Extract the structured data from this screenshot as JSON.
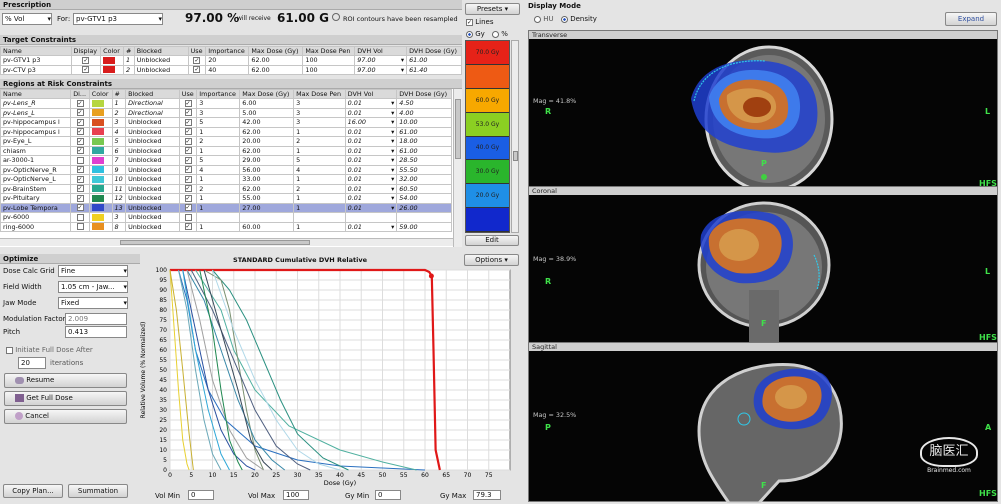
{
  "prescription": {
    "title": "Prescription",
    "type": "% Vol",
    "for_label": "For:",
    "target": "pv-GTV1 p3",
    "percent": "97.00 %",
    "receive_label": "will receive",
    "dose": "61.00 G",
    "msg": "ROI contours have been resampled"
  },
  "presets": {
    "label": "Presets",
    "lines_label": "Lines",
    "gy_label": "Gy",
    "pct_label": "%",
    "edit_label": "Edit",
    "bands": [
      {
        "color": "#e62218",
        "label": "70.0 Gy"
      },
      {
        "color": "#ee5a14",
        "label": ""
      },
      {
        "color": "#f7a800",
        "label": "60.0 Gy"
      },
      {
        "color": "#8bcf22",
        "label": "53.0 Gy"
      },
      {
        "color": "#1a5ee4",
        "label": "40.0 Gy"
      },
      {
        "color": "#2ab52c",
        "label": "30.0 Gy"
      },
      {
        "color": "#1f8fe6",
        "label": "20.0 Gy"
      },
      {
        "color": "#1128cc",
        "label": ""
      }
    ]
  },
  "target_constraints": {
    "title": "Target Constraints",
    "headers": [
      "Name",
      "Display",
      "Color",
      "#",
      "Blocked",
      "Use",
      "Importance",
      "Max Dose (Gy)",
      "Max Dose Pen",
      "DVH Vol",
      "DVH Dose (Gy)"
    ],
    "rows": [
      {
        "name": "pv-GTV1 p3",
        "display": "✓",
        "color": "#d81c1c",
        "num": "1",
        "blocked": "Unblocked",
        "use": "✓",
        "imp": "20",
        "maxd": "62.00",
        "pen": "100",
        "vol": "97.00",
        "dvhd": "61.00"
      },
      {
        "name": "pv-CTV p3",
        "display": "✓",
        "color": "#d81c1c",
        "num": "2",
        "blocked": "Unblocked",
        "use": "✓",
        "imp": "40",
        "maxd": "62.00",
        "pen": "100",
        "vol": "97.00",
        "dvhd": "61.40"
      }
    ]
  },
  "oar_constraints": {
    "title": "Regions at Risk Constraints",
    "headers": [
      "Name",
      "Di...",
      "Color",
      "#",
      "Blocked",
      "Use",
      "Importance",
      "Max Dose (Gy)",
      "Max Dose Pen",
      "DVH Vol",
      "DVH Dose (Gy)"
    ],
    "rows": [
      {
        "name": "pv-Lens_R",
        "display": "✓",
        "color": "#b6d640",
        "num": "1",
        "blocked": "Directional",
        "use": "✓",
        "imp": "3",
        "maxd": "6.00",
        "pen": "3",
        "vol": "0.01",
        "dvhd": "4.50",
        "sel": false
      },
      {
        "name": "pv-Lens_L",
        "display": "✓",
        "color": "#e8a020",
        "num": "2",
        "blocked": "Directional",
        "use": "✓",
        "imp": "3",
        "maxd": "5.00",
        "pen": "3",
        "vol": "0.01",
        "dvhd": "4.00",
        "sel": false
      },
      {
        "name": "pv-hippocampus l",
        "display": "✓",
        "color": "#d85020",
        "num": "3",
        "blocked": "Unblocked",
        "use": "✓",
        "imp": "5",
        "maxd": "42.00",
        "pen": "3",
        "vol": "16.00",
        "dvhd": "10.00",
        "sel": false
      },
      {
        "name": "pv-hippocampus l",
        "display": "✓",
        "color": "#e84050",
        "num": "4",
        "blocked": "Unblocked",
        "use": "✓",
        "imp": "1",
        "maxd": "62.00",
        "pen": "1",
        "vol": "0.01",
        "dvhd": "61.00",
        "sel": false
      },
      {
        "name": "pv-Eye_L",
        "display": "✓",
        "color": "#78c850",
        "num": "5",
        "blocked": "Unblocked",
        "use": "✓",
        "imp": "2",
        "maxd": "20.00",
        "pen": "2",
        "vol": "0.01",
        "dvhd": "18.00",
        "sel": false
      },
      {
        "name": "chiasm",
        "display": "✓",
        "color": "#30a8a0",
        "num": "6",
        "blocked": "Unblocked",
        "use": "✓",
        "imp": "1",
        "maxd": "62.00",
        "pen": "1",
        "vol": "0.01",
        "dvhd": "61.00",
        "sel": false
      },
      {
        "name": "ar-3000-1",
        "display": "",
        "color": "#e040d0",
        "num": "7",
        "blocked": "Unblocked",
        "use": "✓",
        "imp": "5",
        "maxd": "29.00",
        "pen": "5",
        "vol": "0.01",
        "dvhd": "28.50",
        "sel": false
      },
      {
        "name": "pv-OpticNerve_R",
        "display": "✓",
        "color": "#30c0e0",
        "num": "9",
        "blocked": "Unblocked",
        "use": "✓",
        "imp": "4",
        "maxd": "56.00",
        "pen": "4",
        "vol": "0.01",
        "dvhd": "55.50",
        "sel": false
      },
      {
        "name": "pv-OpticNerve_L",
        "display": "✓",
        "color": "#40c8d8",
        "num": "10",
        "blocked": "Unblocked",
        "use": "✓",
        "imp": "1",
        "maxd": "33.00",
        "pen": "1",
        "vol": "0.01",
        "dvhd": "32.00",
        "sel": false
      },
      {
        "name": "pv-BrainStem",
        "display": "✓",
        "color": "#28a890",
        "num": "11",
        "blocked": "Unblocked",
        "use": "✓",
        "imp": "2",
        "maxd": "62.00",
        "pen": "2",
        "vol": "0.01",
        "dvhd": "60.50",
        "sel": false
      },
      {
        "name": "pv-Pituitary",
        "display": "✓",
        "color": "#208850",
        "num": "12",
        "blocked": "Unblocked",
        "use": "✓",
        "imp": "1",
        "maxd": "55.00",
        "pen": "1",
        "vol": "0.01",
        "dvhd": "54.00",
        "sel": false
      },
      {
        "name": "pv-Lobe Tempora",
        "display": "✓",
        "color": "#3048c8",
        "num": "13",
        "blocked": "Unblocked",
        "use": "✓",
        "imp": "1",
        "maxd": "27.00",
        "pen": "1",
        "vol": "0.01",
        "dvhd": "26.00",
        "sel": true
      },
      {
        "name": "pv-6000",
        "display": "",
        "color": "#f0d020",
        "num": "3",
        "blocked": "Unblocked",
        "use": "",
        "imp": "",
        "maxd": "",
        "pen": "",
        "vol": "",
        "dvhd": "",
        "sel": false
      },
      {
        "name": "ring-6000",
        "display": "",
        "color": "#e89020",
        "num": "8",
        "blocked": "Unblocked",
        "use": "✓",
        "imp": "1",
        "maxd": "60.00",
        "pen": "1",
        "vol": "0.01",
        "dvhd": "59.00",
        "sel": false
      }
    ]
  },
  "optimize": {
    "title": "Optimize",
    "fields": [
      {
        "label": "Dose Calc Grid",
        "value": "Fine"
      },
      {
        "label": "Field Width",
        "value": "1.05 cm - Jaw..."
      },
      {
        "label": "Jaw Mode",
        "value": "Fixed"
      }
    ],
    "mod_label": "Modulation Factor",
    "mod_value": "2.009",
    "pitch_label": "Pitch",
    "pitch_value": "0.413",
    "initiate_label": "Initiate Full Dose After",
    "iter_value": "20",
    "iter_label": "iterations",
    "resume": "Resume",
    "get_full": "Get Full Dose",
    "cancel": "Cancel",
    "copy_plan": "Copy Plan...",
    "summation": "Summation"
  },
  "dvh": {
    "title": "STANDARD Cumulative DVH Relative",
    "options": "Options",
    "vol_min_label": "Vol Min",
    "vol_min": "0",
    "vol_max_label": "Vol Max",
    "vol_max": "100",
    "gy_min_label": "Gy Min",
    "gy_min": "0",
    "gy_max_label": "Gy Max",
    "gy_max": "79.3"
  },
  "chart_data": {
    "type": "line",
    "title": "STANDARD Cumulative DVH Relative",
    "xlabel": "Dose (Gy)",
    "ylabel": "Relative Volume (% Normalized)",
    "xlim": [
      0,
      80
    ],
    "ylim": [
      0,
      100
    ],
    "xticks": [
      0,
      5,
      10,
      15,
      20,
      25,
      30,
      35,
      40,
      45,
      50,
      55,
      60,
      65,
      70,
      75
    ],
    "yticks": [
      0,
      5,
      10,
      15,
      20,
      25,
      30,
      35,
      40,
      45,
      50,
      55,
      60,
      65,
      70,
      75,
      80,
      85,
      90,
      95,
      100
    ],
    "series": [
      {
        "color": "#e01818",
        "x": [
          0,
          60,
          61,
          61.6,
          62,
          62.5,
          63.5
        ],
        "y": [
          100,
          100,
          99,
          97,
          60,
          10,
          0
        ]
      },
      {
        "color": "#e8d030",
        "x": [
          0,
          1,
          2,
          3,
          4,
          4.5
        ],
        "y": [
          100,
          70,
          40,
          15,
          3,
          0
        ]
      },
      {
        "color": "#c8b030",
        "x": [
          0,
          1.5,
          3,
          4.5,
          5.5
        ],
        "y": [
          100,
          80,
          50,
          18,
          0
        ]
      },
      {
        "color": "#2a70c0",
        "x": [
          2,
          4,
          6,
          9,
          13,
          20,
          30,
          40,
          50,
          60
        ],
        "y": [
          100,
          85,
          60,
          40,
          25,
          12,
          5,
          2,
          1,
          0
        ]
      },
      {
        "color": "#50b0a0",
        "x": [
          6,
          9,
          12,
          15,
          20,
          28,
          40,
          50,
          58
        ],
        "y": [
          100,
          90,
          80,
          60,
          40,
          22,
          10,
          4,
          0
        ]
      },
      {
        "color": "#2a9080",
        "x": [
          10,
          14,
          18,
          22,
          26,
          30,
          36,
          42
        ],
        "y": [
          100,
          90,
          75,
          55,
          35,
          18,
          6,
          0
        ]
      },
      {
        "color": "#7a9070",
        "x": [
          8,
          12,
          14,
          16,
          18,
          20,
          22
        ],
        "y": [
          100,
          95,
          80,
          55,
          30,
          10,
          0
        ]
      },
      {
        "color": "#3888a8",
        "x": [
          4,
          8,
          12,
          16,
          20,
          24,
          27
        ],
        "y": [
          100,
          85,
          60,
          35,
          15,
          5,
          0
        ]
      },
      {
        "color": "#6aa8b8",
        "x": [
          2,
          4,
          6,
          8,
          10,
          12
        ],
        "y": [
          100,
          80,
          50,
          25,
          8,
          0
        ]
      },
      {
        "color": "#2a50a0",
        "x": [
          3,
          6,
          9,
          12,
          15,
          18,
          20
        ],
        "y": [
          100,
          70,
          40,
          20,
          8,
          2,
          0
        ]
      },
      {
        "color": "#506080",
        "x": [
          5,
          10,
          15,
          20,
          25,
          30,
          33
        ],
        "y": [
          100,
          80,
          55,
          30,
          12,
          3,
          0
        ]
      },
      {
        "color": "#384858",
        "x": [
          8,
          12,
          16,
          19,
          22,
          24
        ],
        "y": [
          100,
          70,
          40,
          15,
          4,
          0
        ]
      },
      {
        "color": "#a0a0a0",
        "x": [
          4,
          7,
          10,
          14,
          18,
          22
        ],
        "y": [
          100,
          75,
          45,
          20,
          6,
          0
        ]
      },
      {
        "color": "#208850",
        "x": [
          7,
          10,
          12,
          14,
          16,
          17
        ],
        "y": [
          100,
          70,
          40,
          15,
          4,
          0
        ]
      },
      {
        "color": "#30a8d8",
        "x": [
          3,
          6,
          9,
          12,
          14
        ],
        "y": [
          100,
          60,
          30,
          8,
          0
        ]
      },
      {
        "color": "#b0d8e8",
        "x": [
          10,
          15,
          20,
          25,
          30,
          35,
          40
        ],
        "y": [
          100,
          70,
          45,
          25,
          10,
          3,
          0
        ]
      }
    ]
  },
  "display_mode": {
    "title": "Display Mode",
    "hu": "HU",
    "density": "Density",
    "expand": "Expand"
  },
  "views": [
    {
      "name": "Transverse",
      "mag": "Mag = 41.8%",
      "left": "R",
      "right": "L",
      "bottom": "P",
      "hfs": "HFS"
    },
    {
      "name": "Coronal",
      "mag": "Mag = 38.9%",
      "left": "R",
      "right": "L",
      "bottom": "F",
      "hfs": "HFS"
    },
    {
      "name": "Sagittal",
      "mag": "Mag = 32.5%",
      "left": "P",
      "right": "A",
      "bottom": "F",
      "hfs": "HFS"
    }
  ],
  "watermark": {
    "text": "脑医汇",
    "sub": "Brainmed.com"
  }
}
